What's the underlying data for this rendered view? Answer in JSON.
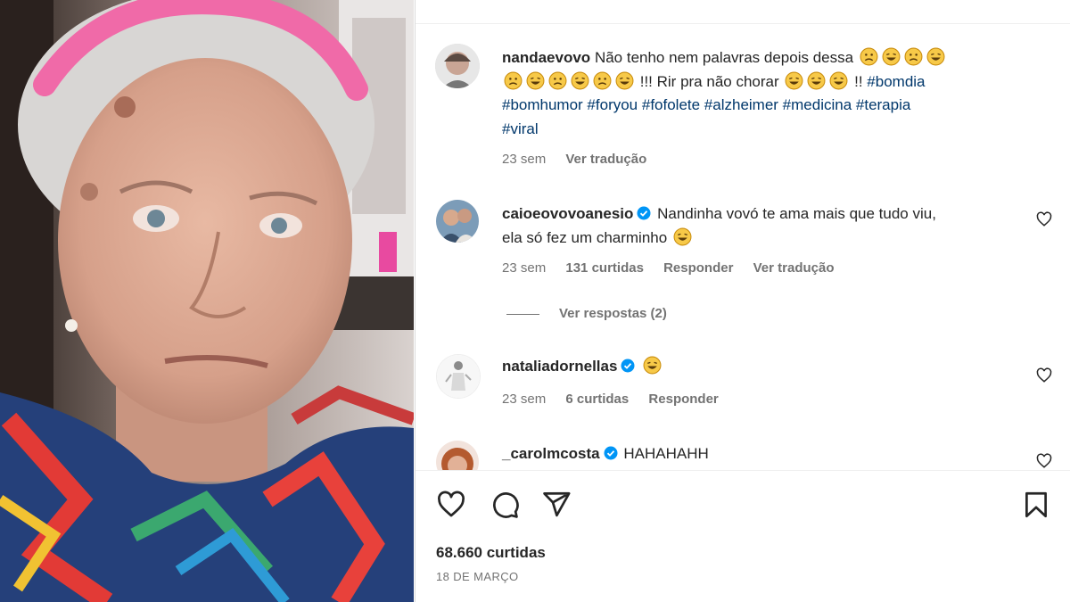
{
  "post": {
    "author": "nandaevovo",
    "caption_text1": "Não tenho nem palavras depois dessa",
    "caption_text2": "!!! Rir pra não chorar",
    "caption_text3": "!!",
    "hashtags_line1": "#bomdia",
    "hashtags_line2": "#bomhumor #foryou #fofolete #alzheimer #medicina #terapia",
    "hashtags_line3": "#viral",
    "time": "23 sem",
    "translate": "Ver tradução"
  },
  "comments": [
    {
      "user": "caioeovovoanesio",
      "text_line1": "Nandinha vovó te ama mais que tudo viu,",
      "text_line2": "ela só fez um charminho",
      "time": "23 sem",
      "likes": "131 curtidas",
      "reply": "Responder",
      "translate": "Ver tradução",
      "view_replies": "Ver respostas (2)"
    },
    {
      "user": "nataliadornellas",
      "time": "23 sem",
      "likes": "6 curtidas",
      "reply": "Responder"
    },
    {
      "user": "_carolmcosta",
      "text": "HAHAHAHH"
    }
  ],
  "footer": {
    "likes": "68.660 curtidas",
    "date": "18 DE MARÇO"
  },
  "icons": {
    "like": "heart-icon",
    "comment": "comment-icon",
    "share": "share-icon",
    "save": "bookmark-icon",
    "verified": "verified-badge-icon"
  },
  "colors": {
    "text": "#262626",
    "muted": "#737373",
    "link": "#00376b",
    "verified": "#0095f6"
  }
}
